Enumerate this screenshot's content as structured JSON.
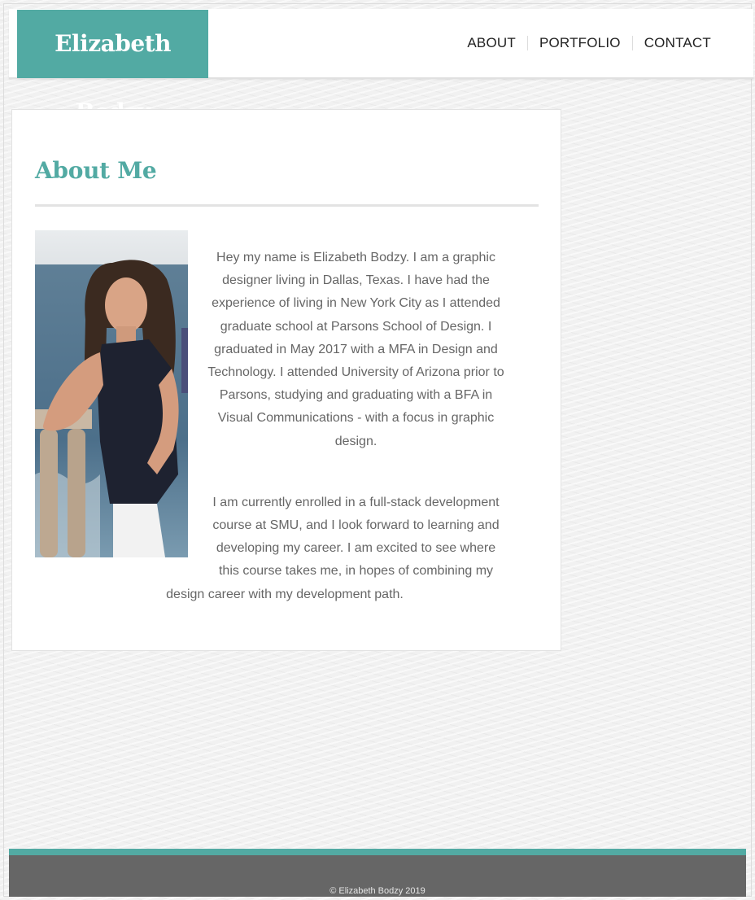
{
  "header": {
    "brand": "Elizabeth Bodzy",
    "nav": [
      "ABOUT",
      "PORTFOLIO",
      "CONTACT"
    ]
  },
  "about": {
    "title": "About Me",
    "paragraph1": "Hey my name is Elizabeth Bodzy. I am a graphic designer living in Dallas, Texas. I have had the experience of living in New York City as I attended graduate school at Parsons School of Design. I graduated in May 2017 with a MFA in Design and Technology. I attended University of Arizona prior to Parsons, studying and graduating with a BFA in Visual Communications - with a focus in graphic design.",
    "paragraph2": "I am currently enrolled in a full-stack development course at SMU, and I look forward to learning and developing my career. I am excited to see where this course takes me, in hopes of combining my design career with my development path."
  },
  "footer": {
    "copyright": "© Elizabeth Bodzy 2019"
  },
  "colors": {
    "accent": "#52aaa3",
    "footer": "#666666",
    "text": "#666666"
  }
}
